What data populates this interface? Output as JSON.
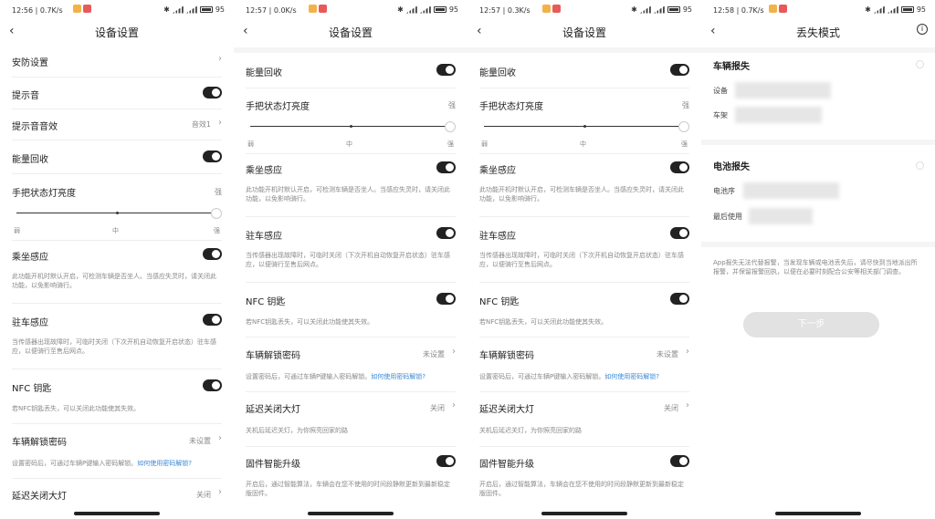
{
  "common": {
    "back": "‹",
    "signal": "5G",
    "battery": "95"
  },
  "s1": {
    "time": "12:56 | 0.7K/s",
    "title": "设备设置",
    "security": "安防设置",
    "tone": "提示音",
    "tone_effect": "提示音音效",
    "tone_effect_val": "音效1",
    "energy": "能量回收",
    "brightness": "手把状态灯亮度",
    "strong": "强",
    "weak": "弱",
    "mid": "中",
    "seat": "乘坐感应",
    "seat_desc": "此功能开机时默认开启，可检测车辆是否坐人。当感应失灵时，请关闭此功能，以免影响骑行。",
    "park": "驻车感应",
    "park_desc": "当传感器出现故障时，可临时关闭（下次开机自动恢复开启状态）驻车感应，以便骑行至售后网点。",
    "nfc": "NFC 钥匙",
    "nfc_desc": "若NFC钥匙丢失，可以关闭此功能使其失效。",
    "unlock": "车辆解锁密码",
    "unlock_val": "未设置",
    "unlock_desc": "设置密码后，可通过车辆P键输入密码解锁。",
    "unlock_link": "如何使用密码解锁?",
    "delay": "延迟关闭大灯",
    "delay_val": "关闭"
  },
  "s2": {
    "time": "12:57 | 0.0K/s",
    "title": "设备设置",
    "energy": "能量回收",
    "brightness": "手把状态灯亮度",
    "strong": "强",
    "weak": "弱",
    "mid": "中",
    "seat": "乘坐感应",
    "seat_desc": "此功能开机时默认开启，可检测车辆是否坐人。当感应失灵时，请关闭此功能，以免影响骑行。",
    "park": "驻车感应",
    "park_desc": "当传感器出现故障时，可临时关闭（下次开机自动恢复开启状态）驻车感应，以便骑行至售后网点。",
    "nfc": "NFC 钥匙",
    "nfc_desc": "若NFC钥匙丢失，可以关闭此功能使其失效。",
    "unlock": "车辆解锁密码",
    "unlock_val": "未设置",
    "unlock_desc": "设置密码后，可通过车辆P键输入密码解锁。",
    "unlock_link": "如何使用密码解锁?",
    "delay": "延迟关闭大灯",
    "delay_val": "关闭",
    "delay_desc": "关机后延迟关灯，为你照亮回家的路",
    "firmware": "固件智能升级",
    "firmware_desc": "开启后，通过智能算法，车辆会在您不使用的时间段静默更新到最新稳定版固件。"
  },
  "s3": {
    "time": "12:57 | 0.3K/s",
    "title": "设备设置",
    "energy": "能量回收",
    "brightness": "手把状态灯亮度",
    "strong": "强",
    "weak": "弱",
    "mid": "中",
    "seat": "乘坐感应",
    "seat_desc": "此功能开机时默认开启，可检测车辆是否坐人。当感应失灵时，请关闭此功能，以免影响骑行。",
    "park": "驻车感应",
    "park_desc": "当传感器出现故障时，可临时关闭（下次开机自动恢复开启状态）驻车感应，以便骑行至售后网点。",
    "nfc": "NFC 钥匙",
    "nfc_desc": "若NFC钥匙丢失，可以关闭此功能使其失效。",
    "unlock": "车辆解锁密码",
    "unlock_val": "未设置",
    "unlock_desc": "设置密码后，可通过车辆P键输入密码解锁。",
    "unlock_link": "如何使用密码解锁?",
    "delay": "延迟关闭大灯",
    "delay_val": "关闭",
    "delay_desc": "关机后延迟关灯，为你照亮回家的路",
    "firmware": "固件智能升级",
    "firmware_desc": "开启后，通过智能算法，车辆会在您不使用的时间段静默更新到最新稳定版固件。"
  },
  "s4": {
    "time": "12:58 | 0.7K/s",
    "title": "丢失模式",
    "info": "i",
    "vehicle_lost": "车辆报失",
    "device": "设备",
    "frame": "车架",
    "battery_lost": "电池报失",
    "battery_sn": "电池序",
    "last_used": "最后使用",
    "notice": "App报失无法代替报警，当发现车辆或电池丢失后，请尽快到当地派出所报警，并保留报警回执，以便在必要时刻配合公安等相关部门调查。",
    "next": "下一步"
  }
}
